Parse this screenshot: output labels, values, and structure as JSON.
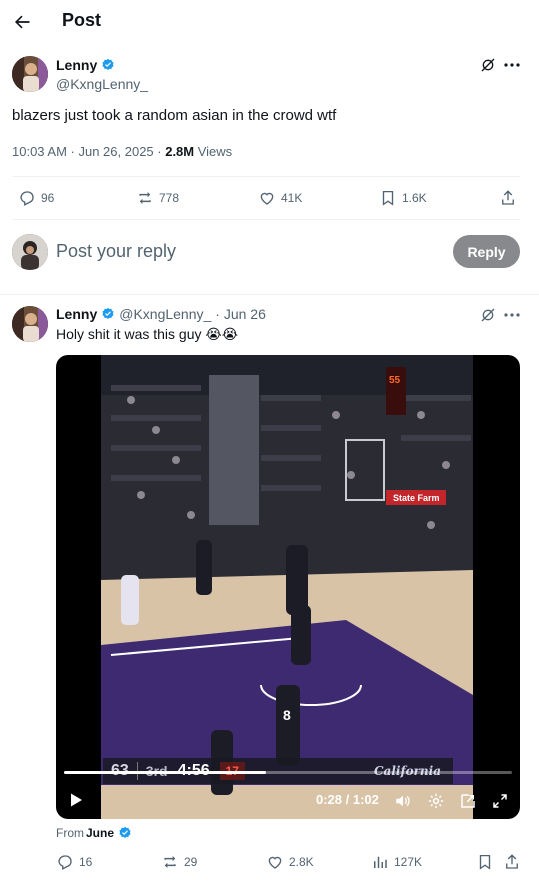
{
  "header": {
    "title": "Post",
    "back_icon": "arrow-left-icon"
  },
  "main_post": {
    "name": "Lenny",
    "handle": "@KxngLenny_",
    "text": "blazers just took a random asian in the crowd wtf",
    "time": "10:03 AM · Jun 26, 2025 · ",
    "views_count": "2.8M",
    "views_label": " Views",
    "actions": {
      "replies": "96",
      "reposts": "778",
      "likes": "41K",
      "bookmarks": "1.6K"
    }
  },
  "reply_box": {
    "placeholder": "Post your reply",
    "button": "Reply"
  },
  "reply_post": {
    "name": "Lenny",
    "handle": "@KxngLenny_",
    "date": "· Jun 26",
    "text": "Holy shit it was this guy 😭😭",
    "video": {
      "time": "0:28 / 1:02",
      "progress": 0.45,
      "score_home": "63",
      "quarter": "3rd",
      "clock": "4:56",
      "shot_clock": "17",
      "sponsor": "California",
      "shot_clock_top": "55",
      "jersey": "8",
      "ad_text": "State Farm"
    },
    "from_label": "From ",
    "from_name": "June",
    "actions": {
      "replies": "16",
      "reposts": "29",
      "likes": "2.8K",
      "views": "127K"
    }
  },
  "colors": {
    "verified": "#1d9bf0",
    "muted": "#536471",
    "court_purple": "#3e2a70",
    "reply_disabled": "#87898c"
  }
}
